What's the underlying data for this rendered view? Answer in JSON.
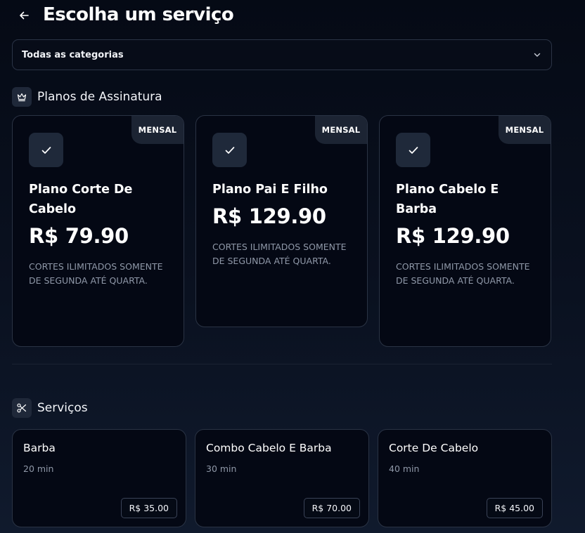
{
  "header": {
    "title": "Escolha um serviço",
    "back_icon": "arrow-left-icon"
  },
  "category_select": {
    "value": "Todas as categorias",
    "icon": "chevron-down-icon"
  },
  "plans_section": {
    "title": "Planos de Assinatura",
    "icon": "crown-icon",
    "plans": [
      {
        "badge": "MENSAL",
        "name": "Plano Corte De Cabelo",
        "price": "R$ 79.90",
        "description": "CORTES ILIMITADOS SOMENTE DE SEGUNDA ATÉ QUARTA."
      },
      {
        "badge": "MENSAL",
        "name": "Plano Pai E Filho",
        "price": "R$ 129.90",
        "description": "CORTES ILIMITADOS SOMENTE DE SEGUNDA ATÉ QUARTA."
      },
      {
        "badge": "MENSAL",
        "name": "Plano Cabelo E Barba",
        "price": "R$ 129.90",
        "description": "CORTES ILIMITADOS SOMENTE DE SEGUNDA ATÉ QUARTA."
      }
    ]
  },
  "services_section": {
    "title": "Serviços",
    "icon": "scissors-icon",
    "services": [
      {
        "name": "Barba",
        "duration": "20 min",
        "price": "R$ 35.00"
      },
      {
        "name": "Combo Cabelo E Barba",
        "duration": "30 min",
        "price": "R$ 70.00"
      },
      {
        "name": "Corte De Cabelo",
        "duration": "40 min",
        "price": "R$ 45.00"
      }
    ]
  },
  "colors": {
    "background": "#0a1120",
    "card": "#040814",
    "badge": "#1c2433",
    "muted_text": "#8f98a8"
  }
}
